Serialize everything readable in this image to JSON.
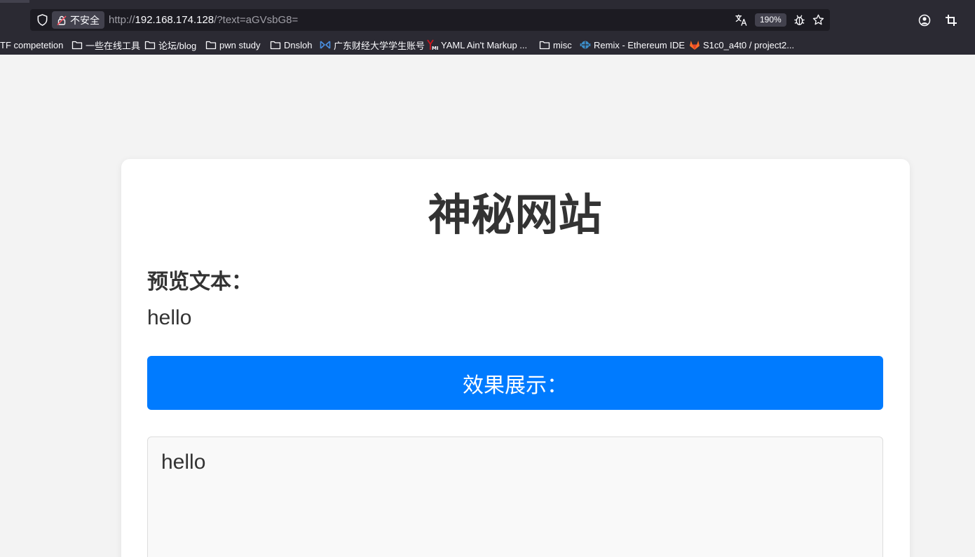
{
  "browser": {
    "security_label": "不安全",
    "url_scheme": "http://",
    "url_host": "192.168.174.128",
    "url_rest": "/?text=aGVsbG8=",
    "zoom_level": "190%",
    "icons": [
      "shield-icon",
      "lock-icon",
      "translate-icon",
      "bug-icon",
      "star-icon",
      "account-icon",
      "crop-icon"
    ]
  },
  "bookmarks": [
    {
      "label": "TF competetion",
      "icon": "none"
    },
    {
      "label": "一些在线工具",
      "icon": "folder-icon"
    },
    {
      "label": "论坛/blog",
      "icon": "folder-icon"
    },
    {
      "label": "pwn study",
      "icon": "folder-icon"
    },
    {
      "label": "Dnsloh",
      "icon": "folder-icon"
    },
    {
      "label": "广东财经大学学生账号",
      "icon": "university-icon"
    },
    {
      "label": "YAML Ain't Markup ...",
      "icon": "yaml-icon"
    },
    {
      "label": "misc",
      "icon": "folder-icon"
    },
    {
      "label": "Remix - Ethereum IDE",
      "icon": "remix-icon"
    },
    {
      "label": "S1c0_a4t0 / project2...",
      "icon": "gitlab-icon"
    }
  ],
  "page": {
    "title": "神秘网站",
    "preview_label": "预览文本：",
    "preview_text": "hello",
    "result_button_label": "效果展示：",
    "result_text": "hello"
  },
  "colors": {
    "chrome_bg": "#2b2a33",
    "url_bar_bg": "#1c1b22",
    "page_bg": "#f3f3f3",
    "accent": "#007bff",
    "text": "#333333"
  }
}
